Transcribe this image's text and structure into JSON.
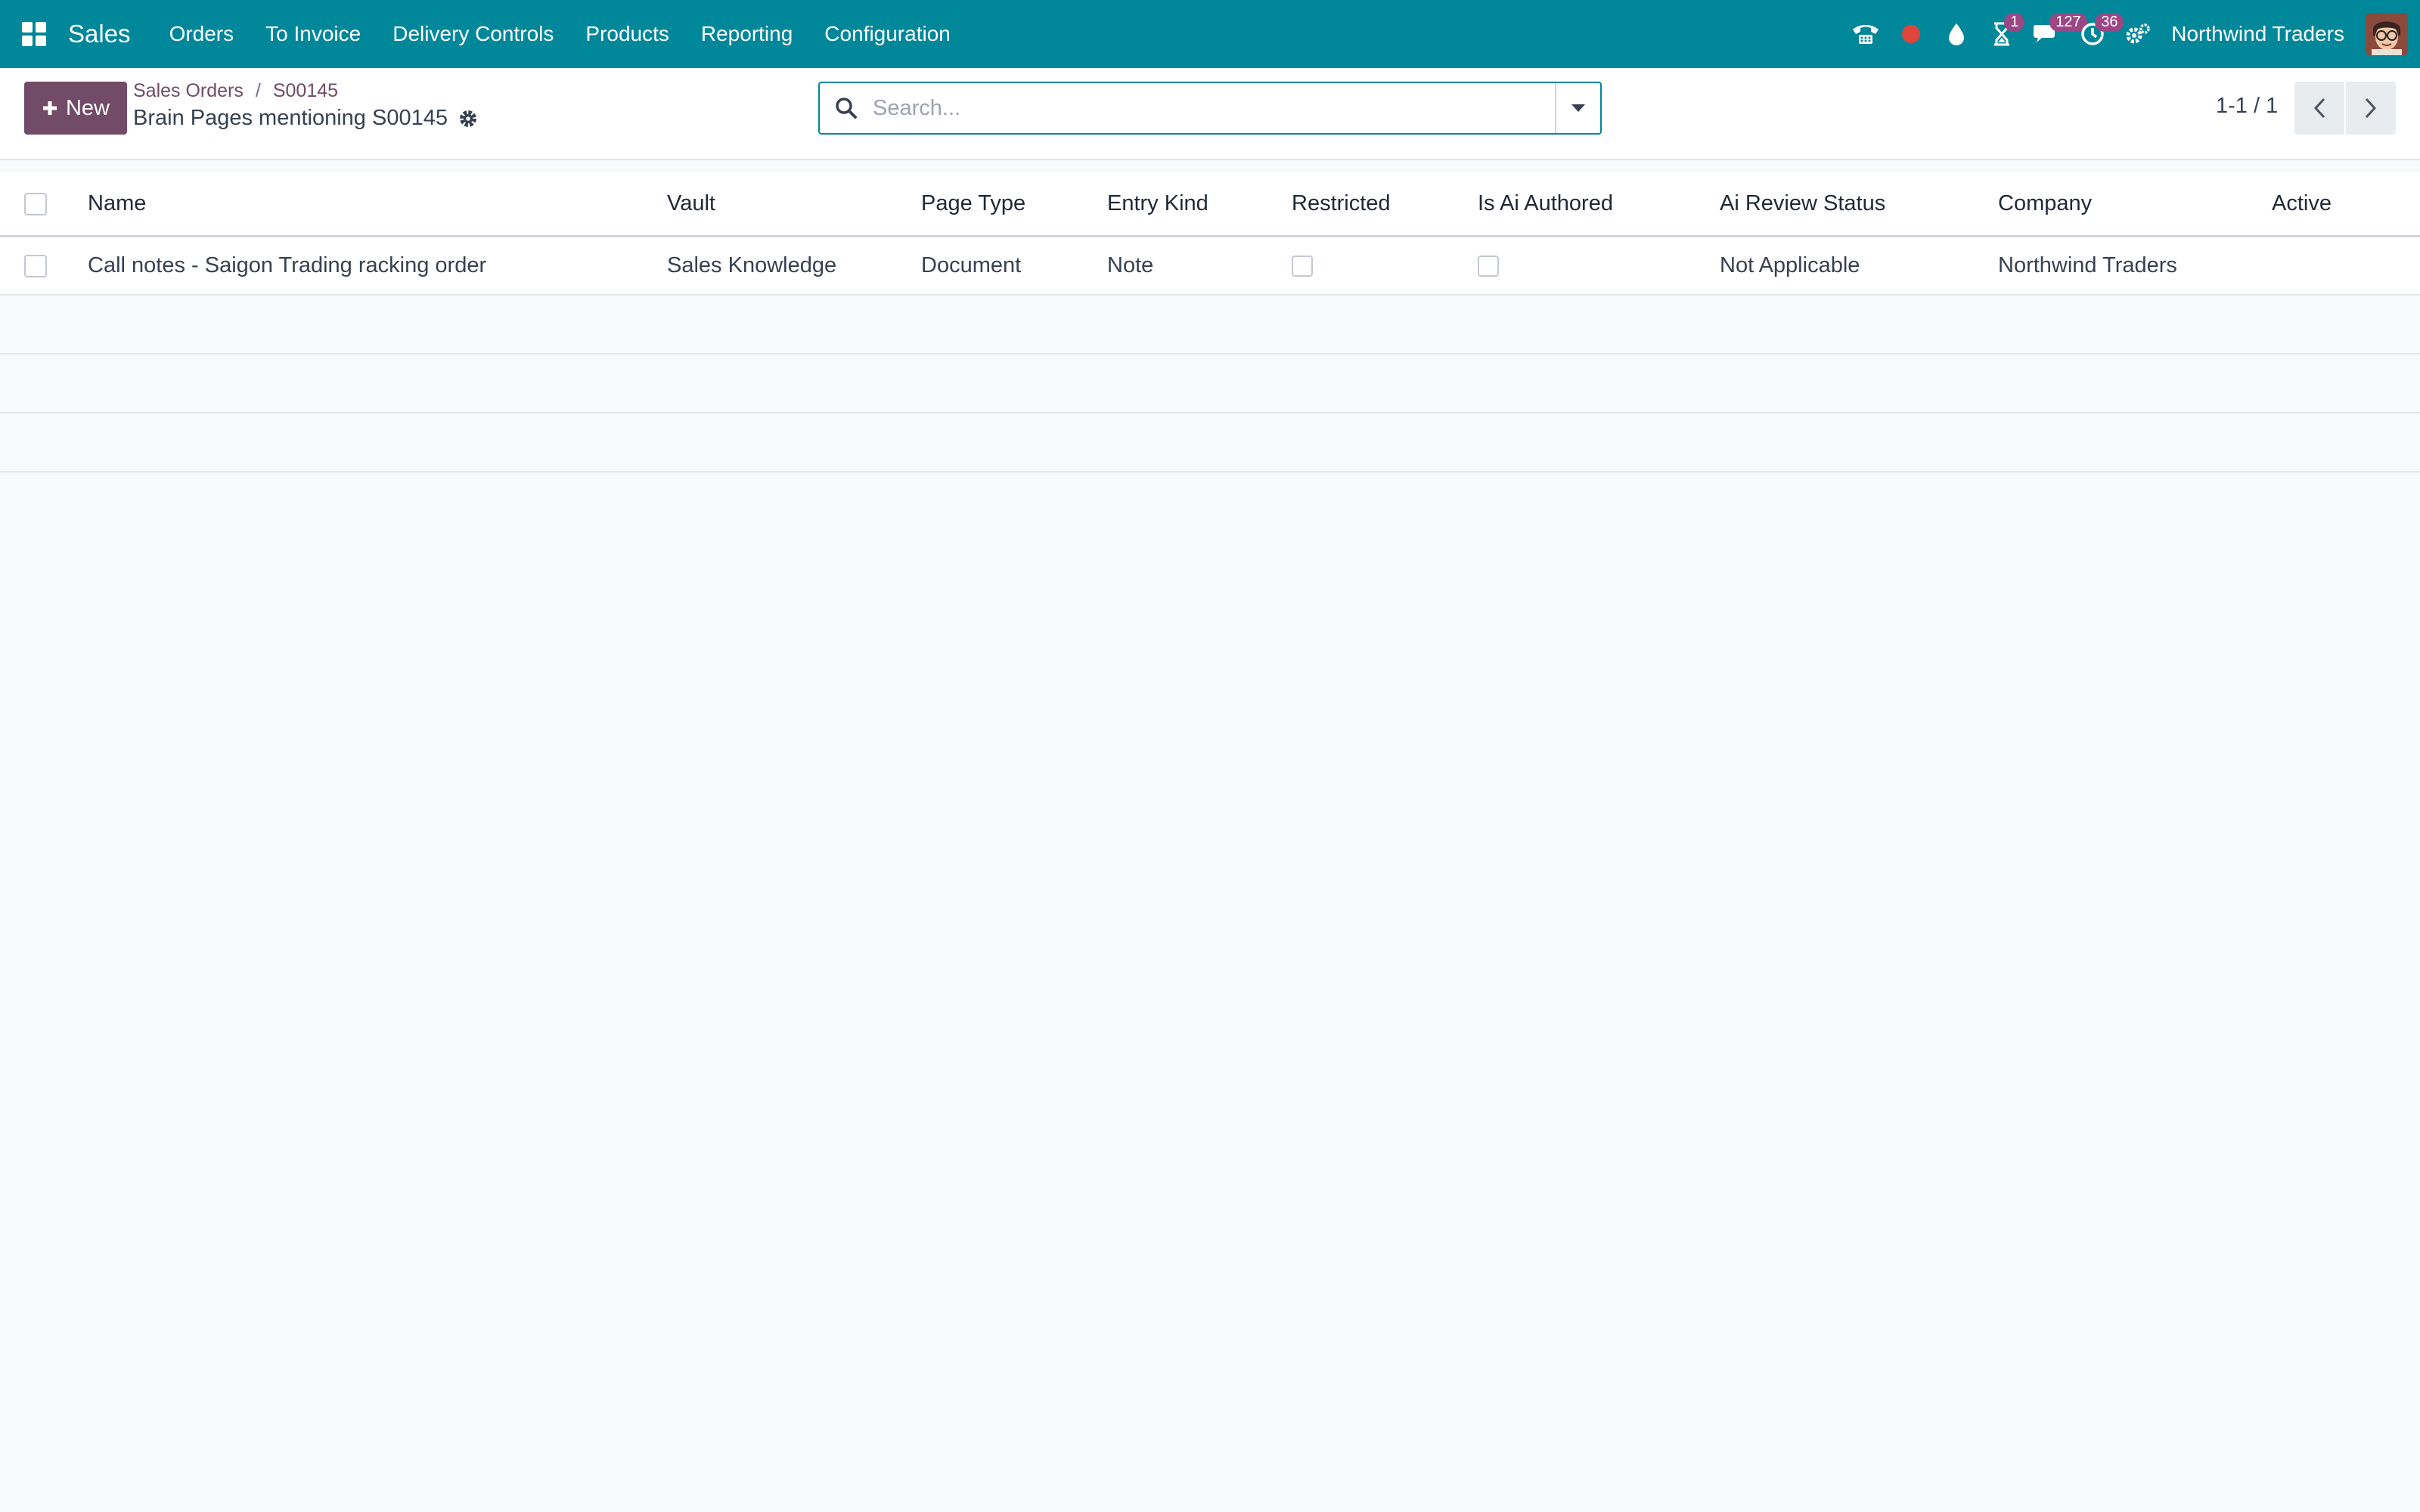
{
  "navbar": {
    "app_name": "Sales",
    "menu": [
      "Orders",
      "To Invoice",
      "Delivery Controls",
      "Products",
      "Reporting",
      "Configuration"
    ],
    "badges": {
      "activities": "1",
      "messages": "127",
      "timer": "36"
    },
    "company": "Northwind Traders",
    "colors": {
      "bar": "#00879a",
      "badge": "#9b4785",
      "recording": "#e0453a"
    }
  },
  "control_panel": {
    "new_label": "New",
    "breadcrumb": [
      "Sales Orders",
      "S00145"
    ],
    "title": "Brain Pages mentioning S00145",
    "search_placeholder": "Search...",
    "pager": "1-1 / 1"
  },
  "table": {
    "columns": [
      "Name",
      "Vault",
      "Page Type",
      "Entry Kind",
      "Restricted",
      "Is Ai Authored",
      "Ai Review Status",
      "Company",
      "Active"
    ],
    "rows": [
      {
        "name": "Call notes - Saigon Trading racking order",
        "vault": "Sales Knowledge",
        "page_type": "Document",
        "entry_kind": "Note",
        "restricted": false,
        "is_ai_authored": false,
        "ai_review_status": "Not Applicable",
        "company": "Northwind Traders",
        "active": ""
      }
    ]
  }
}
